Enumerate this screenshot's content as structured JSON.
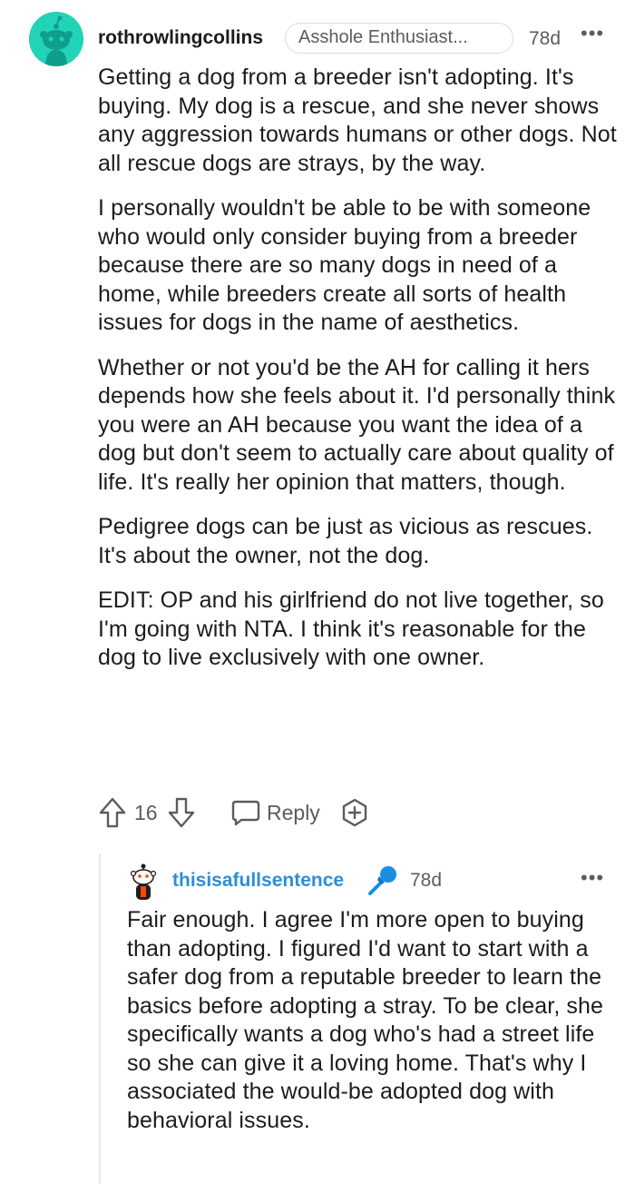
{
  "comment": {
    "username": "rothrowlingcollins",
    "flair": "Asshole Enthusiast...",
    "age": "78d",
    "more_label": "•••",
    "paragraphs": [
      "Getting a dog from a breeder isn't adopting. It's buying. My dog is a rescue, and she never shows any aggression towards humans or other dogs. Not all rescue dogs are strays, by the way.",
      "I personally wouldn't be able to be with someone who would only consider buying from a breeder because there are so many dogs in need of a home, while breeders create all sorts of health issues for dogs in the name of aesthetics.",
      "Whether or not you'd be the AH for calling it hers depends how she feels about it. I'd personally think you were an AH because you want the idea of a dog but don't seem to actually care about quality of life. It's really her opinion that matters, though.",
      "Pedigree dogs can be just as vicious as rescues. It's about the owner, not the dog.",
      "EDIT: OP and his girlfriend do not live together, so I'm going with NTA. I think it's reasonable for the dog to live exclusively with one owner."
    ],
    "score": "16",
    "reply_label": "Reply",
    "avatar_color": "#22d3b8"
  },
  "reply": {
    "username": "thisisafullsentence",
    "username_color": "#2d8ed6",
    "op_badge_icon": "microphone-icon",
    "age": "78d",
    "more_label": "•••",
    "text": "Fair enough. I agree I'm more open to buying than adopting. I figured I'd want to start with a safer dog from a reputable breeder to learn the basics before adopting a stray. To be clear, she specifically wants a dog who's had a street life so she can give it a loving home. That's why I associated the would-be adopted dog with behavioral issues."
  }
}
